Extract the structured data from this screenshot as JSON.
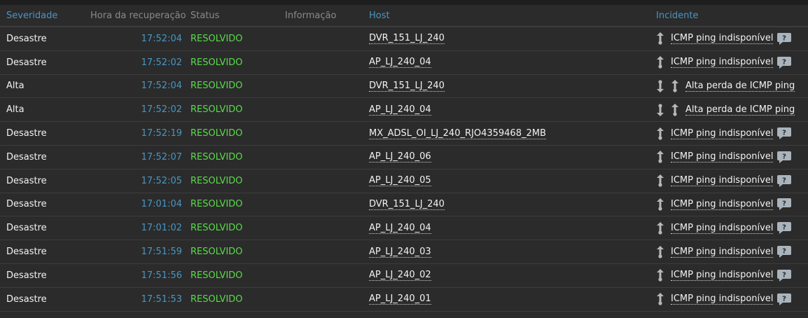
{
  "columns": {
    "severity": "Severidade",
    "recovery_time": "Hora da recuperação",
    "status": "Status",
    "info": "Informação",
    "host": "Host",
    "incident": "Incidente"
  },
  "rows": [
    {
      "severity": "Desastre",
      "time": "17:52:04",
      "status": "RESOLVIDO",
      "host": "DVR_151_LJ_240",
      "incident": "ICMP ping indisponível",
      "arrows": 1,
      "comment": true
    },
    {
      "severity": "Desastre",
      "time": "17:52:02",
      "status": "RESOLVIDO",
      "host": "AP_LJ_240_04",
      "incident": "ICMP ping indisponível",
      "arrows": 1,
      "comment": true
    },
    {
      "severity": "Alta",
      "time": "17:52:04",
      "status": "RESOLVIDO",
      "host": "DVR_151_LJ_240",
      "incident": "Alta perda de ICMP ping",
      "arrows": 2,
      "comment": false
    },
    {
      "severity": "Alta",
      "time": "17:52:02",
      "status": "RESOLVIDO",
      "host": "AP_LJ_240_04",
      "incident": "Alta perda de ICMP ping",
      "arrows": 2,
      "comment": false
    },
    {
      "severity": "Desastre",
      "time": "17:52:19",
      "status": "RESOLVIDO",
      "host": "MX_ADSL_OI_LJ_240_RJO4359468_2MB",
      "incident": "ICMP ping indisponível",
      "arrows": 1,
      "comment": true
    },
    {
      "severity": "Desastre",
      "time": "17:52:07",
      "status": "RESOLVIDO",
      "host": "AP_LJ_240_06",
      "incident": "ICMP ping indisponível",
      "arrows": 1,
      "comment": true
    },
    {
      "severity": "Desastre",
      "time": "17:52:05",
      "status": "RESOLVIDO",
      "host": "AP_LJ_240_05",
      "incident": "ICMP ping indisponível",
      "arrows": 1,
      "comment": true
    },
    {
      "severity": "Desastre",
      "time": "17:01:04",
      "status": "RESOLVIDO",
      "host": "DVR_151_LJ_240",
      "incident": "ICMP ping indisponível",
      "arrows": 1,
      "comment": true
    },
    {
      "severity": "Desastre",
      "time": "17:01:02",
      "status": "RESOLVIDO",
      "host": "AP_LJ_240_04",
      "incident": "ICMP ping indisponível",
      "arrows": 1,
      "comment": true
    },
    {
      "severity": "Desastre",
      "time": "17:51:59",
      "status": "RESOLVIDO",
      "host": "AP_LJ_240_03",
      "incident": "ICMP ping indisponível",
      "arrows": 1,
      "comment": true
    },
    {
      "severity": "Desastre",
      "time": "17:51:56",
      "status": "RESOLVIDO",
      "host": "AP_LJ_240_02",
      "incident": "ICMP ping indisponível",
      "arrows": 1,
      "comment": true
    },
    {
      "severity": "Desastre",
      "time": "17:51:53",
      "status": "RESOLVIDO",
      "host": "AP_LJ_240_01",
      "incident": "ICMP ping indisponível",
      "arrows": 1,
      "comment": true
    }
  ],
  "icons": {
    "arrow": "up-down-arrow-icon",
    "comment": "comment-icon"
  },
  "colors": {
    "link": "#4796c4",
    "resolved": "#59db4a",
    "background": "#2b2b2b"
  }
}
